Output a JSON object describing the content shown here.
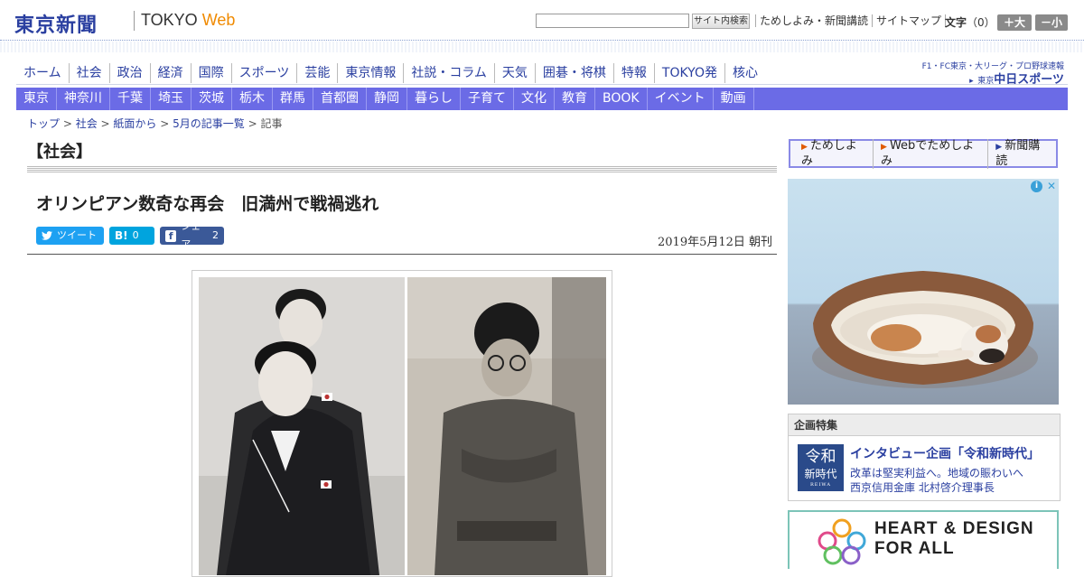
{
  "header": {
    "logo": "東京新聞",
    "logo_tokyo": "TOKYO",
    "logo_web": "Web",
    "search_placeholder": "",
    "search_button": "サイト内検索",
    "util_links": [
      "ためしよみ・新聞講読",
      "サイトマップ"
    ],
    "font_size_label": "文字",
    "font_size_count": "（0）",
    "font_larger": "＋大",
    "font_smaller": "－小"
  },
  "main_nav": [
    "ホーム",
    "社会",
    "政治",
    "経済",
    "国際",
    "スポーツ",
    "芸能",
    "東京情報",
    "社説・コラム",
    "天気",
    "囲碁・将棋",
    "特報",
    "TOKYO発",
    "核心"
  ],
  "sports_promo": {
    "line1": "F1・FC東京・大リーグ・プロ野球速報",
    "line2_small": "東京",
    "line2_main": "中日スポーツ"
  },
  "sub_nav": [
    "東京",
    "神奈川",
    "千葉",
    "埼玉",
    "茨城",
    "栃木",
    "群馬",
    "首都圏",
    "静岡",
    "暮らし",
    "子育て",
    "文化",
    "教育",
    "BOOK",
    "イベント",
    "動画"
  ],
  "breadcrumb": [
    {
      "label": "トップ",
      "sep": " > "
    },
    {
      "label": "社会",
      "sep": " > "
    },
    {
      "label": "紙面から",
      "sep": " > "
    },
    {
      "label": "5月の記事一覧",
      "sep": " > "
    },
    {
      "label": "記事",
      "sep": ""
    }
  ],
  "article": {
    "section": "【社会】",
    "headline": "オリンピアン数奇な再会　旧満州で戦禍逃れ",
    "share": {
      "tweet": "ツイート",
      "hatena_icon": "B!",
      "hatena_count": "0",
      "facebook_label": "シェア",
      "facebook_count": "2"
    },
    "date": "2019年5月12日 朝刊"
  },
  "sidebar": {
    "trial_links": [
      "ためしよみ",
      "Webでためしよみ",
      "新聞購読"
    ],
    "kikaku": {
      "heading": "企画特集",
      "logo_l1": "令和",
      "logo_l2": "新時代",
      "logo_l3": "REIWA",
      "title": "インタビュー企画「令和新時代」",
      "desc1": "改革は堅実利益へ。地域の賑わいへ",
      "desc2": "西京信用金庫 北村啓介理事長"
    },
    "banner_text_1": "HEART & DESIGN",
    "banner_text_2": "FOR ALL"
  },
  "colors": {
    "brand_blue": "#2a3fa0",
    "subnav_bg": "#6b6be6",
    "twitter": "#1da1f2",
    "hatena": "#00a4de",
    "facebook": "#3b5998"
  }
}
